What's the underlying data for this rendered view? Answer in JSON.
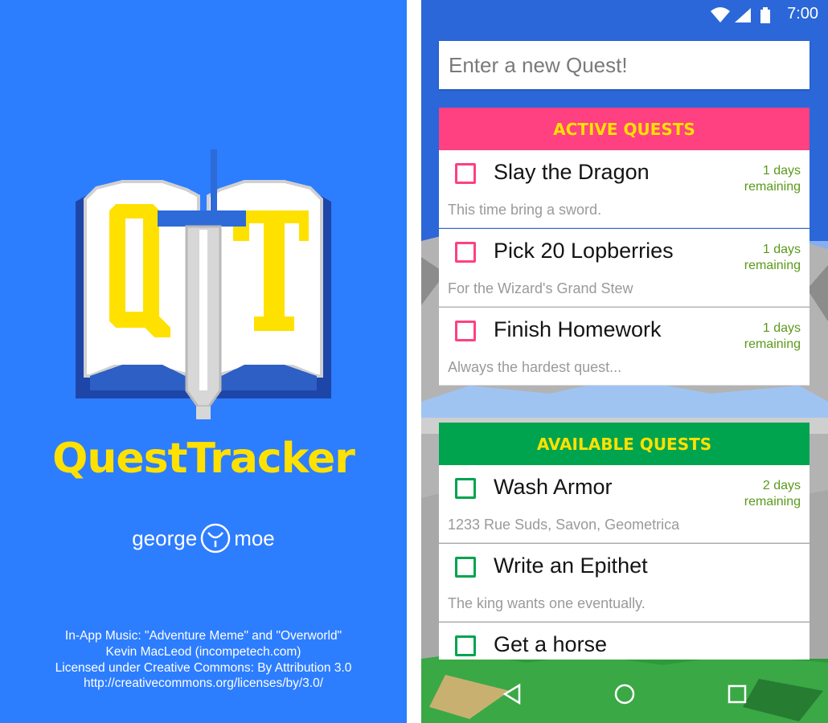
{
  "splash": {
    "app_name": "QuestTracker",
    "logo_letters": "QT",
    "brand_left": "george",
    "brand_right": "moe",
    "credits": [
      "In-App Music: \"Adventure Meme\" and \"Overworld\"",
      "Kevin MacLeod (incompetech.com)",
      "Licensed under Creative Commons: By Attribution 3.0",
      "http://creativecommons.org/licenses/by/3.0/"
    ]
  },
  "statusbar": {
    "time": "7:00",
    "icons": [
      "wifi-icon",
      "signal-icon",
      "battery-icon"
    ]
  },
  "quest_input": {
    "placeholder": "Enter a new Quest!",
    "value": ""
  },
  "active": {
    "header": "ACTIVE QUESTS",
    "color": "#ff4081",
    "quests": [
      {
        "title": "Slay the Dragon",
        "days": "1 days",
        "remaining": "remaining",
        "desc": "This time bring a sword."
      },
      {
        "title": "Pick 20 Lopberries",
        "days": "1 days",
        "remaining": "remaining",
        "desc": "For the Wizard's Grand Stew"
      },
      {
        "title": "Finish Homework",
        "days": "1 days",
        "remaining": "remaining",
        "desc": "Always the hardest quest..."
      }
    ]
  },
  "available": {
    "header": "AVAILABLE QUESTS",
    "color": "#00a44f",
    "quests": [
      {
        "title": "Wash Armor",
        "days": "2 days",
        "remaining": "remaining",
        "desc": "1233 Rue Suds, Savon, Geometrica"
      },
      {
        "title": "Write an Epithet",
        "days": "",
        "remaining": "",
        "desc": "The king wants one eventually."
      },
      {
        "title": "Get a horse",
        "days": "",
        "remaining": "",
        "desc": ""
      }
    ]
  },
  "navbar": {
    "buttons": [
      "back-icon",
      "home-icon",
      "recents-icon"
    ]
  },
  "colors": {
    "splash_bg": "#2d7dff",
    "brand_yellow": "#ffe100",
    "days_green": "#5a9a1a"
  }
}
